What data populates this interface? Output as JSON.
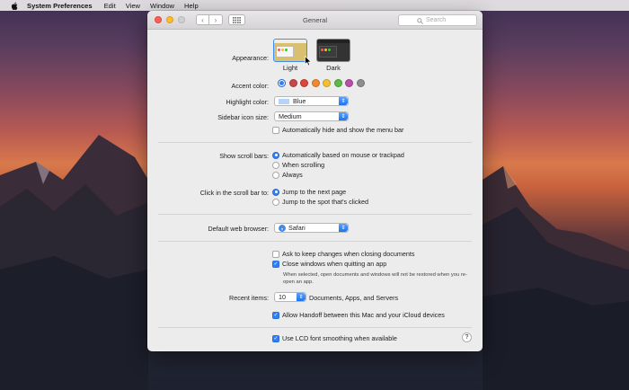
{
  "menubar": {
    "app": "System Preferences",
    "items": [
      "Edit",
      "View",
      "Window",
      "Help"
    ]
  },
  "window": {
    "title": "General",
    "search_placeholder": "Search"
  },
  "appearance": {
    "label": "Appearance:",
    "options": [
      "Light",
      "Dark"
    ],
    "selected": "Light"
  },
  "accent": {
    "label": "Accent color:",
    "colors": [
      "#2f7ff6",
      "#b84ea8",
      "#e0443a",
      "#f0892f",
      "#f5c030",
      "#5cba47",
      "#9a5ec8",
      "#8e8e8e"
    ]
  },
  "highlight": {
    "label": "Highlight color:",
    "value": "Blue",
    "swatch": "#b6d3fb"
  },
  "sidebar_icon": {
    "label": "Sidebar icon size:",
    "value": "Medium"
  },
  "menu_bar_auto_hide": "Automatically hide and show the menu bar",
  "scroll_bars": {
    "label": "Show scroll bars:",
    "options": [
      "Automatically based on mouse or trackpad",
      "When scrolling",
      "Always"
    ],
    "selected_index": 0
  },
  "click_scroll": {
    "label": "Click in the scroll bar to:",
    "options": [
      "Jump to the next page",
      "Jump to the spot that's clicked"
    ],
    "selected_index": 0
  },
  "browser": {
    "label": "Default web browser:",
    "value": "Safari"
  },
  "ask_keep_changes": "Ask to keep changes when closing documents",
  "close_windows": "Close windows when quitting an app",
  "close_windows_note": "When selected, open documents and windows will not be restored when you re-open an app.",
  "recent": {
    "label": "Recent items:",
    "value": "10",
    "suffix": "Documents, Apps, and Servers"
  },
  "handoff": "Allow Handoff between this Mac and your iCloud devices",
  "lcd": "Use LCD font smoothing when available",
  "help": "?"
}
